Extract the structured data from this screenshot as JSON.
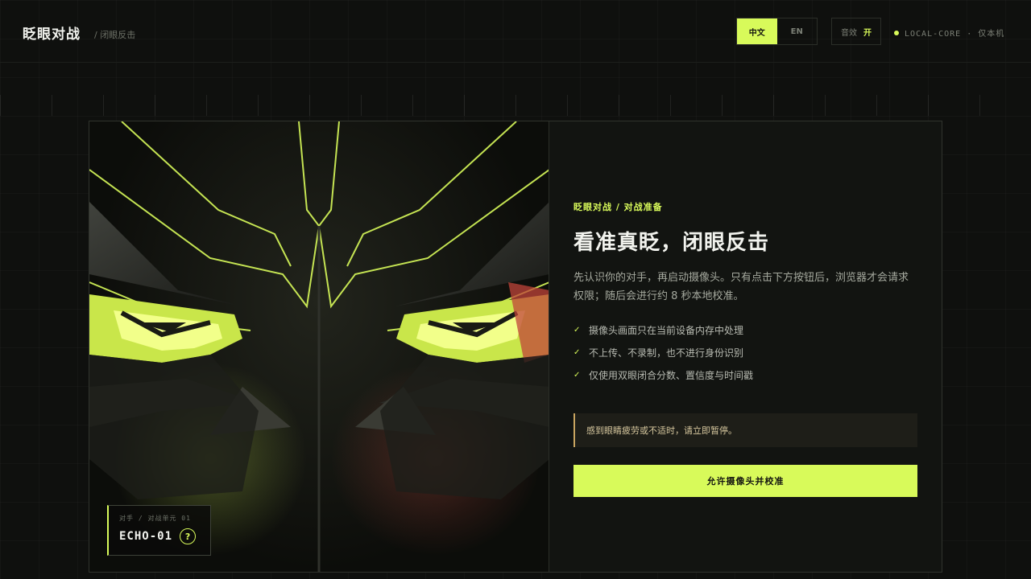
{
  "header": {
    "brand": "眨眼对战",
    "breadcrumb": "/ 闭眼反击",
    "languages": [
      {
        "label": "中文",
        "active": true
      },
      {
        "label": "EN",
        "active": false
      }
    ],
    "sound": {
      "label": "音效",
      "state": "开"
    },
    "status": "LOCAL-CORE · 仅本机"
  },
  "opponent": {
    "label": "对手 / 对战单元 01",
    "name": "ECHO-01",
    "help": "?"
  },
  "panel": {
    "eyebrow": "眨眼对战 / 对战准备",
    "headline": "看准真眨，闭眼反击",
    "description": "先认识你的对手，再启动摄像头。只有点击下方按钮后，浏览器才会请求权限；随后会进行约 8 秒本地校准。",
    "checklist": [
      "摄像头画面只在当前设备内存中处理",
      "不上传、不录制，也不进行身份识别",
      "仅使用双眼闭合分数、置信度与时间戳"
    ],
    "check_icon": "✓",
    "warning": "感到眼睛疲劳或不适时，请立即暂停。",
    "cta": "允许摄像头并校准"
  },
  "colors": {
    "accent": "#d8fa5a",
    "warning_border": "#c9a560",
    "background": "#0f100e"
  }
}
